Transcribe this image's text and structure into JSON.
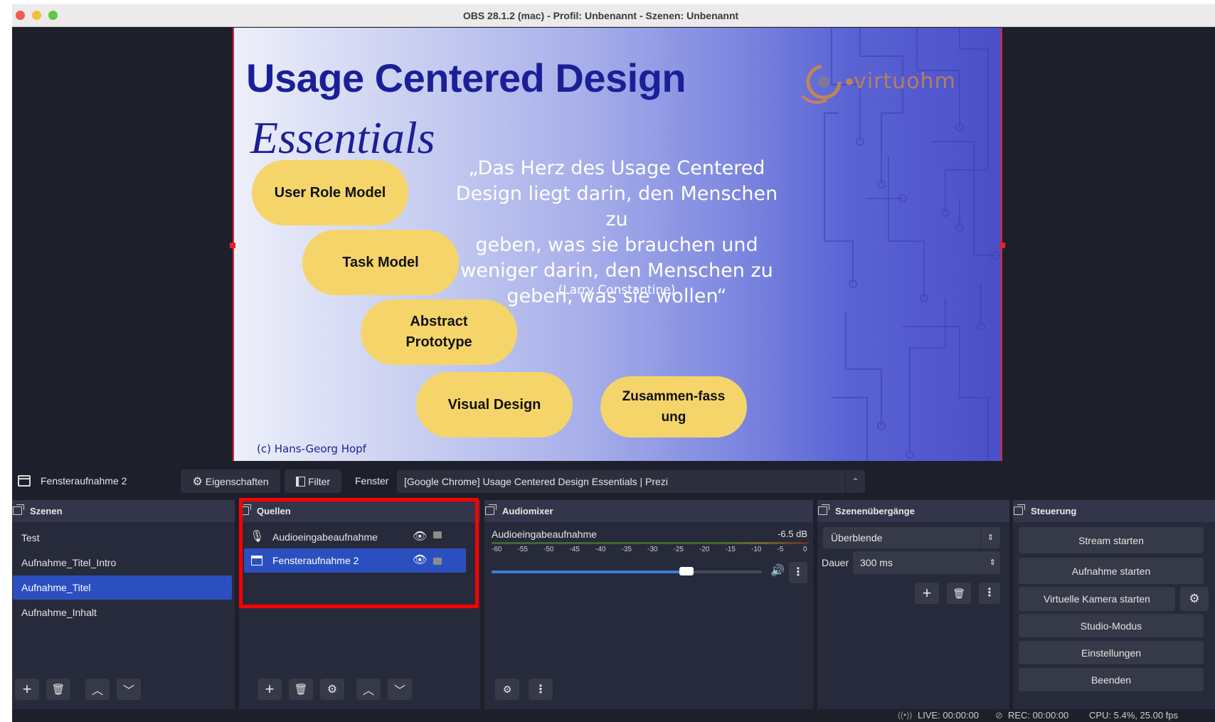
{
  "window": {
    "title": "OBS 28.1.2 (mac) - Profil: Unbenannt - Szenen: Unbenannt"
  },
  "preview": {
    "slide": {
      "title": "Usage Centered Design",
      "subtitle": "Essentials",
      "logo_text": "virtuohm",
      "pills": [
        "User Role Model",
        "Task Model",
        "Abstract Prototype",
        "Visual Design",
        "Zusammen-fassung"
      ],
      "quote_lines": [
        "„Das Herz des Usage Centered",
        "Design liegt darin, den Menschen zu",
        "geben, was sie brauchen und",
        "weniger darin, den Menschen zu",
        "geben, was sie wollen“"
      ],
      "quote_author": "(Larry Constantine)",
      "copyright": "(c) Hans-Georg Hopf",
      "colors": {
        "title": "#1b1f97",
        "pill": "#f5d56a",
        "selection_border": "#e0242c"
      }
    }
  },
  "context_bar": {
    "source_name": "Fensteraufnahme 2",
    "properties_label": "Eigenschaften",
    "filter_label": "Filter",
    "window_label": "Fenster",
    "window_value": "[Google Chrome] Usage Centered Design Essentials | Prezi"
  },
  "scenes": {
    "title": "Szenen",
    "items": [
      "Test",
      "Aufnahme_Titel_Intro",
      "Aufnahme_Titel",
      "Aufnahme_Inhalt"
    ],
    "selected_index": 2
  },
  "sources": {
    "title": "Quellen",
    "items": [
      {
        "name": "Audioeingabeaufnahme",
        "icon": "microphone-icon",
        "visible": true,
        "locked": false
      },
      {
        "name": "Fensteraufnahme 2",
        "icon": "window-capture-icon",
        "visible": true,
        "locked": false
      }
    ],
    "selected_index": 1
  },
  "audio_mixer": {
    "title": "Audiomixer",
    "channel_name": "Audioeingabeaufnahme",
    "level": "-6.5 dB",
    "scale": [
      "-60",
      "-55",
      "-50",
      "-45",
      "-40",
      "-35",
      "-30",
      "-25",
      "-20",
      "-15",
      "-10",
      "-5",
      "0"
    ],
    "volume_fraction": 0.72
  },
  "transitions": {
    "title": "Szenenübergänge",
    "selected": "Überblende",
    "duration_label": "Dauer",
    "duration_value": "300 ms"
  },
  "controls": {
    "title": "Steuerung",
    "stream": "Stream starten",
    "record": "Aufnahme starten",
    "virtual_cam": "Virtuelle Kamera starten",
    "studio": "Studio-Modus",
    "settings": "Einstellungen",
    "exit": "Beenden"
  },
  "status": {
    "live": "LIVE: 00:00:00",
    "rec": "REC: 00:00:00",
    "cpu": "CPU: 5.4%, 25.00 fps"
  }
}
